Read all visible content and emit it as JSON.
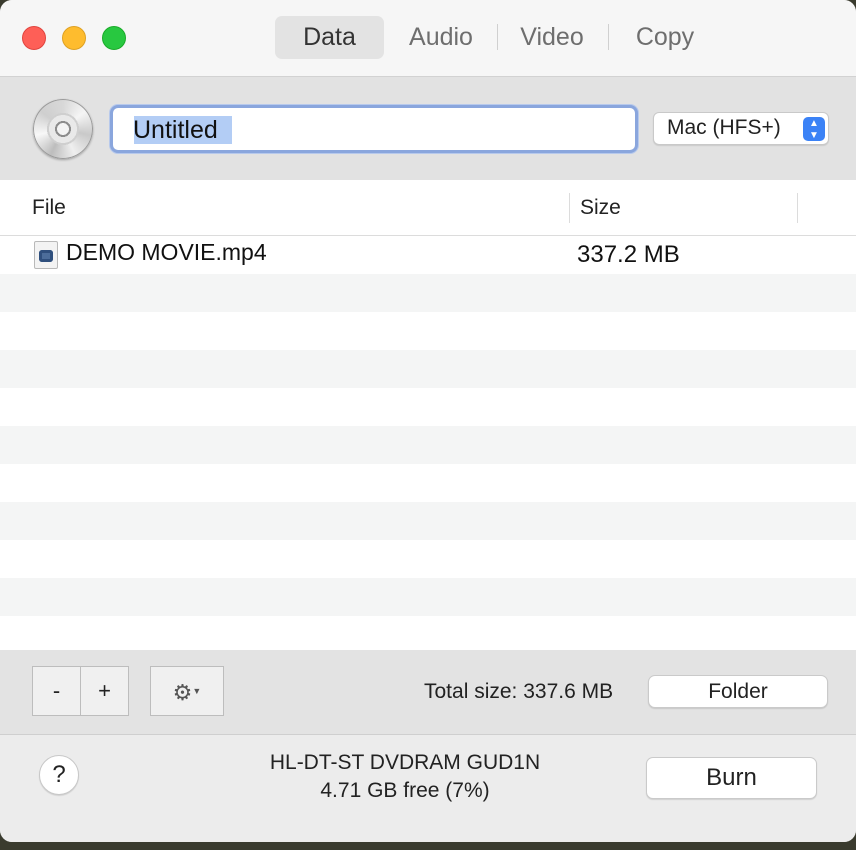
{
  "tabs": [
    {
      "label": "Data",
      "active": true
    },
    {
      "label": "Audio",
      "active": false
    },
    {
      "label": "Video",
      "active": false
    },
    {
      "label": "Copy",
      "active": false
    }
  ],
  "disc": {
    "name_value": "Untitled",
    "filesystem": "Mac (HFS+)"
  },
  "table": {
    "columns": [
      "File",
      "Size"
    ],
    "rows": [
      {
        "file": "DEMO MOVIE.mp4",
        "size": "337.2 MB"
      }
    ]
  },
  "toolbar": {
    "remove_label": "-",
    "add_label": "+",
    "total_size": "Total size: 337.6 MB",
    "folder_label": "Folder"
  },
  "footer": {
    "help_label": "?",
    "drive_name": "HL-DT-ST DVDRAM GUD1N",
    "drive_free": "4.71 GB free (7%)",
    "burn_label": "Burn"
  },
  "colors": {
    "close": "#fe5f57",
    "minimize": "#febc2e",
    "maximize": "#28c840",
    "accent": "#3b82f6",
    "selection": "#b3cdf5"
  }
}
